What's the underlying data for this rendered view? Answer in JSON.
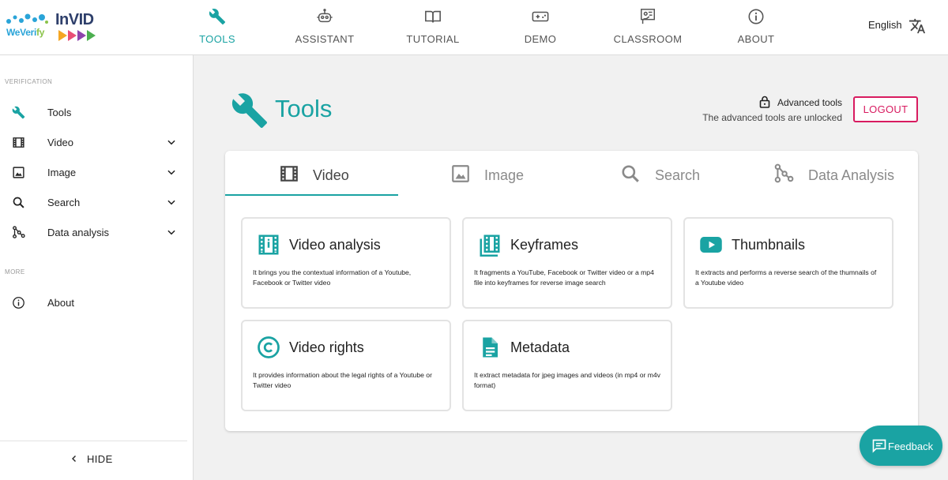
{
  "brand": {
    "weverify_part1": "WeVeri",
    "weverify_part2": "fy",
    "invid": "InVID"
  },
  "nav": {
    "items": [
      {
        "label": "TOOLS",
        "icon": "wrench-icon",
        "active": true
      },
      {
        "label": "ASSISTANT",
        "icon": "robot-icon",
        "active": false
      },
      {
        "label": "TUTORIAL",
        "icon": "book-icon",
        "active": false
      },
      {
        "label": "DEMO",
        "icon": "gamepad-icon",
        "active": false
      },
      {
        "label": "CLASSROOM",
        "icon": "classroom-icon",
        "active": false
      },
      {
        "label": "ABOUT",
        "icon": "info-icon",
        "active": false
      }
    ],
    "language": "English"
  },
  "sidebar": {
    "verification_title": "VERIFICATION",
    "items": [
      {
        "label": "Tools",
        "icon": "wrench-icon",
        "expandable": false
      },
      {
        "label": "Video",
        "icon": "film-icon",
        "expandable": true
      },
      {
        "label": "Image",
        "icon": "image-icon",
        "expandable": true
      },
      {
        "label": "Search",
        "icon": "search-icon",
        "expandable": true
      },
      {
        "label": "Data analysis",
        "icon": "graph-icon",
        "expandable": true
      }
    ],
    "more_title": "MORE",
    "about": {
      "label": "About",
      "icon": "info-icon"
    },
    "hide_label": "HIDE"
  },
  "main": {
    "title": "Tools",
    "advanced_label": "Advanced tools",
    "advanced_status": "The advanced tools are unlocked",
    "logout_label": "LOGOUT",
    "tabs": [
      {
        "label": "Video",
        "icon": "film-icon",
        "active": true
      },
      {
        "label": "Image",
        "icon": "image-icon",
        "active": false
      },
      {
        "label": "Search",
        "icon": "search-icon",
        "active": false
      },
      {
        "label": "Data Analysis",
        "icon": "graph-icon",
        "active": false
      }
    ],
    "cards": [
      {
        "title": "Video analysis",
        "icon": "video-analysis-icon",
        "description": "It brings you the contextual information of a Youtube, Facebook or Twitter video"
      },
      {
        "title": "Keyframes",
        "icon": "keyframes-icon",
        "description": "It fragments a YouTube, Facebook or Twitter video or a mp4 file into keyframes for reverse image search"
      },
      {
        "title": "Thumbnails",
        "icon": "youtube-icon",
        "description": "It extracts and performs a reverse search of the thumnails of a Youtube video"
      },
      {
        "title": "Video rights",
        "icon": "copyright-icon",
        "description": "It provides information about the legal rights of a Youtube or Twitter video"
      },
      {
        "title": "Metadata",
        "icon": "document-icon",
        "description": "It extract metadata for jpeg images and videos (in mp4 or m4v format)"
      }
    ]
  },
  "feedback": {
    "label": "Feedback"
  },
  "colors": {
    "accent": "#1aa3a3",
    "logout": "#d81b60",
    "icon_gray": "#555555"
  }
}
